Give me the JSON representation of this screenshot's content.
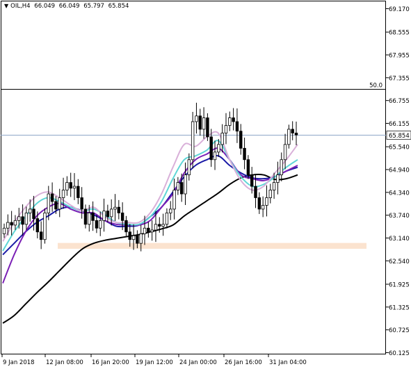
{
  "header": {
    "symbol": "OIL,H4",
    "open": "66.049",
    "high": "66.049",
    "low": "65.797",
    "close": "65.854"
  },
  "level_line": {
    "label": "50.0",
    "price": 67.06
  },
  "current_price": {
    "label": "65.854",
    "value": 65.854
  },
  "support_zone": {
    "from": 62.93,
    "to": 63.01,
    "color": "#fbe3cf"
  },
  "colors": {
    "candle": "#000000",
    "ma_black": "#000000",
    "ma_navy": "#1a1aa6",
    "ma_purple": "#7a1fb5",
    "ma_cyan": "#5fd6d6",
    "ma_pink": "#d9b0d9",
    "price_line": "#8ea6c8"
  },
  "chart_data": {
    "type": "candlestick",
    "symbol": "OIL",
    "timeframe": "H4",
    "y_ticks": [
      "69.170",
      "68.555",
      "67.955",
      "67.355",
      "66.755",
      "66.155",
      "65.540",
      "64.940",
      "64.340",
      "63.740",
      "63.140",
      "62.540",
      "61.925",
      "61.325",
      "60.725",
      "60.125"
    ],
    "x_ticks": [
      "9 Jan 2018",
      "12 Jan 08:00",
      "16 Jan 20:00",
      "19 Jan 12:00",
      "24 Jan 00:00",
      "26 Jan 16:00",
      "31 Jan 04:00"
    ],
    "ylim": [
      60.125,
      69.17
    ],
    "closes": [
      63.4,
      63.55,
      63.48,
      63.6,
      63.7,
      63.5,
      63.8,
      63.9,
      63.65,
      63.3,
      63.1,
      63.8,
      64.3,
      64.1,
      63.9,
      64.2,
      64.4,
      64.6,
      64.45,
      64.5,
      64.2,
      63.9,
      63.5,
      63.8,
      63.6,
      63.4,
      63.6,
      63.85,
      63.7,
      63.9,
      63.95,
      63.8,
      63.6,
      63.3,
      63.1,
      63.2,
      63.0,
      63.25,
      63.4,
      63.3,
      63.35,
      63.5,
      63.45,
      63.5,
      63.8,
      63.9,
      64.4,
      64.6,
      64.3,
      64.8,
      65.2,
      66.2,
      66.35,
      66.0,
      66.3,
      65.8,
      65.2,
      65.4,
      65.6,
      65.9,
      66.1,
      66.3,
      66.2,
      65.95,
      65.5,
      65.2,
      64.8,
      64.5,
      64.2,
      63.9,
      64.0,
      64.2,
      64.4,
      64.6,
      64.8,
      65.2,
      65.6,
      66.0,
      65.9,
      65.85
    ],
    "series": [
      {
        "name": "",
        "color": "#000000",
        "values": [
          60.9,
          61.1,
          61.4,
          61.7,
          61.98,
          62.28,
          62.58,
          62.85,
          63.0,
          63.08,
          63.13,
          63.18,
          63.23,
          63.3,
          63.38,
          63.48,
          63.72,
          63.92,
          64.12,
          64.32,
          64.55,
          64.72,
          64.8,
          64.8,
          64.68,
          64.7,
          64.8
        ]
      },
      {
        "name": "",
        "color": "#1a1aa6",
        "values": [
          62.7,
          63.0,
          63.3,
          63.55,
          63.72,
          63.9,
          63.95,
          63.85,
          63.75,
          63.6,
          63.45,
          63.45,
          63.48,
          63.7,
          63.95,
          64.35,
          64.75,
          65.05,
          65.2,
          65.3,
          65.05,
          64.85,
          64.72,
          64.7,
          64.75,
          64.9,
          65.0
        ]
      },
      {
        "name": "",
        "color": "#7a1fb5",
        "values": [
          61.95,
          62.7,
          63.3,
          63.72,
          63.95,
          64.05,
          63.9,
          63.8,
          63.8,
          63.6,
          63.5,
          63.48,
          63.48,
          63.6,
          63.95,
          64.3,
          64.85,
          65.2,
          65.35,
          65.5,
          65.2,
          64.8,
          64.7,
          64.65,
          64.75,
          64.9,
          65.05
        ]
      },
      {
        "name": "",
        "color": "#5fd6d6",
        "values": [
          62.8,
          63.3,
          63.7,
          64.05,
          64.2,
          64.1,
          63.95,
          63.85,
          63.9,
          63.75,
          63.55,
          63.5,
          63.5,
          63.7,
          64.1,
          64.7,
          65.2,
          65.3,
          65.45,
          65.7,
          65.2,
          64.75,
          64.5,
          64.55,
          64.75,
          65.0,
          65.2
        ]
      },
      {
        "name": "",
        "color": "#d9b0d9",
        "values": [
          63.05,
          63.55,
          63.95,
          64.25,
          64.35,
          64.2,
          64.0,
          63.85,
          63.95,
          63.7,
          63.55,
          63.55,
          63.55,
          63.8,
          64.3,
          65.0,
          65.6,
          65.55,
          65.8,
          65.9,
          65.2,
          64.65,
          64.4,
          64.5,
          64.85,
          65.2,
          65.6
        ]
      }
    ]
  }
}
